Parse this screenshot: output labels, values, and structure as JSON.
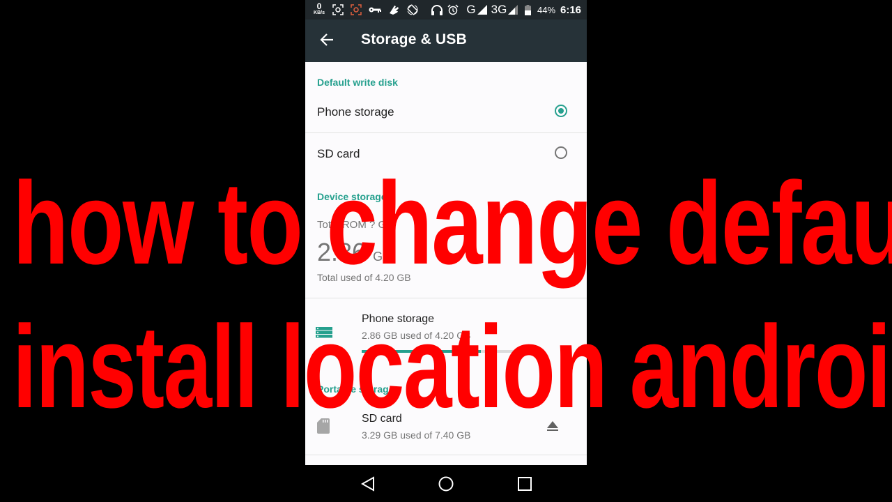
{
  "status_bar": {
    "network_speed_value": "0",
    "network_speed_unit": "KB/s",
    "icons": [
      "screenshot-icon",
      "screen-record-icon",
      "vpn-key-icon",
      "hand-icon",
      "auto-rotate-icon",
      "headphones-icon",
      "alarm-icon",
      "signal-g-icon",
      "signal-3g-icon",
      "battery-icon"
    ],
    "network_1": "G",
    "network_2": "3G",
    "battery_percent": "44%",
    "time": "6:16"
  },
  "app_bar": {
    "title": "Storage & USB",
    "back_icon": "arrow-back-icon"
  },
  "default_write_disk": {
    "header": "Default write disk",
    "options": [
      {
        "label": "Phone storage",
        "selected": true
      },
      {
        "label": "SD card",
        "selected": false
      }
    ]
  },
  "device_storage": {
    "header": "Device storage",
    "total_label": "Total ROM ? GB",
    "used_value": "2.86",
    "used_unit": "GB",
    "total_used_text": "Total used of 4.20 GB"
  },
  "volumes": {
    "phone_storage": {
      "title": "Phone storage",
      "summary": "2.86 GB used of 4.20 GB",
      "used_fraction": 0.68,
      "accent_color": "#26a08e"
    },
    "portable_header": "Portable storage",
    "sd_card": {
      "title": "SD card",
      "summary": "3.29 GB used of 7.40 GB",
      "action_icon": "eject-icon"
    }
  },
  "nav_bar": {
    "buttons": [
      "back-icon",
      "home-icon",
      "recents-icon"
    ]
  },
  "overlay": {
    "line1": "how to change default",
    "line2": "install location android",
    "color": "#ff0000"
  }
}
